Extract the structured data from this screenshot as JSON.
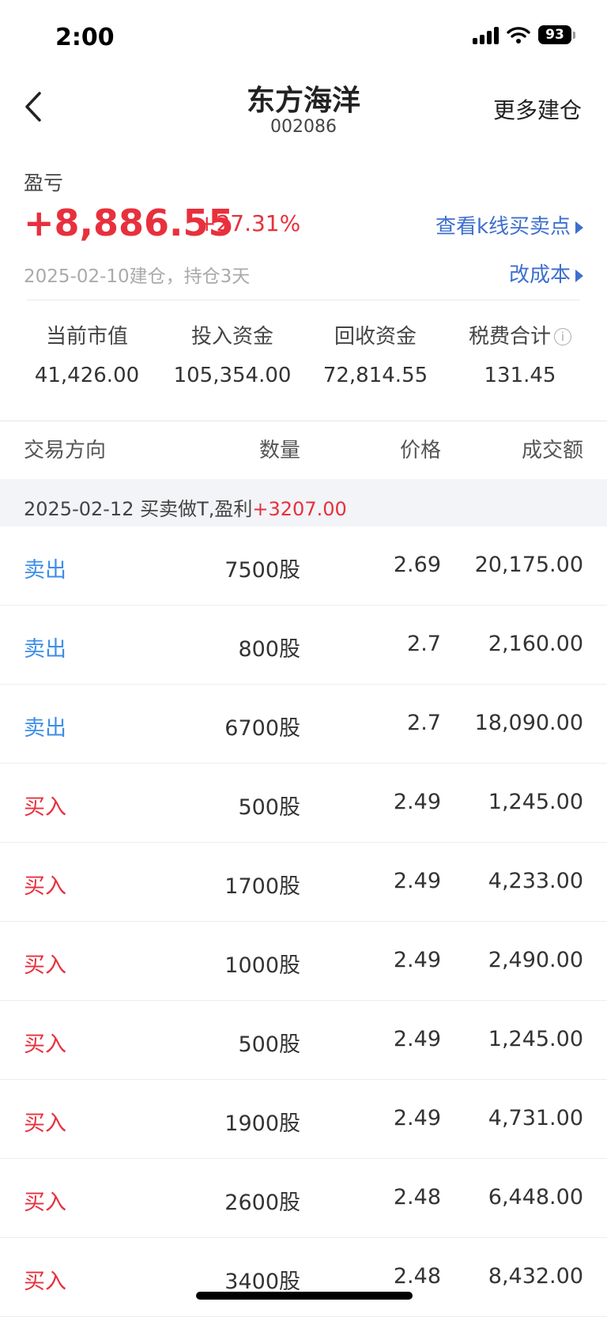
{
  "status_bar": {
    "time": "2:00",
    "battery": "93"
  },
  "nav": {
    "title": "东方海洋",
    "code": "002086",
    "more_label": "更多建仓"
  },
  "pnl": {
    "label": "盈亏",
    "value": "+8,886.55",
    "percent": "+27.31%",
    "kline_link": "查看k线买卖点",
    "date_note": "2025-02-10建仓，持仓3天",
    "cost_link": "改成本"
  },
  "stats": [
    {
      "label": "当前市值",
      "value": "41,426.00"
    },
    {
      "label": "投入资金",
      "value": "105,354.00"
    },
    {
      "label": "回收资金",
      "value": "72,814.55"
    },
    {
      "label": "税费合计",
      "value": "131.45"
    }
  ],
  "table": {
    "headers": [
      "交易方向",
      "数量",
      "价格",
      "成交额"
    ],
    "group": {
      "label": "2025-02-12 买卖做T,盈利",
      "profit": "+3207.00"
    },
    "rows": [
      {
        "direction": "卖出",
        "qty": "7500股",
        "price": "2.69",
        "amount": "20,175.00"
      },
      {
        "direction": "卖出",
        "qty": "800股",
        "price": "2.7",
        "amount": "2,160.00"
      },
      {
        "direction": "卖出",
        "qty": "6700股",
        "price": "2.7",
        "amount": "18,090.00"
      },
      {
        "direction": "买入",
        "qty": "500股",
        "price": "2.49",
        "amount": "1,245.00"
      },
      {
        "direction": "买入",
        "qty": "1700股",
        "price": "2.49",
        "amount": "4,233.00"
      },
      {
        "direction": "买入",
        "qty": "1000股",
        "price": "2.49",
        "amount": "2,490.00"
      },
      {
        "direction": "买入",
        "qty": "500股",
        "price": "2.49",
        "amount": "1,245.00"
      },
      {
        "direction": "买入",
        "qty": "1900股",
        "price": "2.49",
        "amount": "4,731.00"
      },
      {
        "direction": "买入",
        "qty": "2600股",
        "price": "2.48",
        "amount": "6,448.00"
      },
      {
        "direction": "买入",
        "qty": "3400股",
        "price": "2.48",
        "amount": "8,432.00"
      }
    ]
  },
  "colors": {
    "profit_red": "#e8303d",
    "sell_blue": "#3e8ee8",
    "link_blue": "#3e6fcf"
  }
}
